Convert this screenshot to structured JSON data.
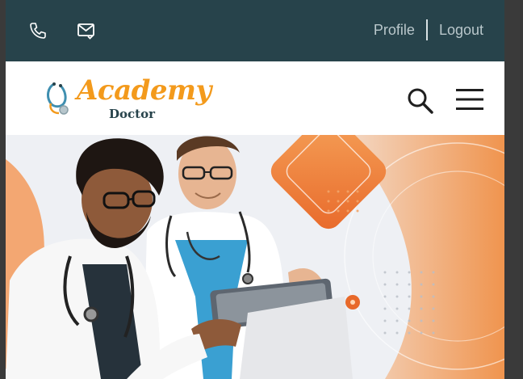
{
  "topbar": {
    "phone_icon": "phone-icon",
    "mail_icon": "mail-check-icon",
    "profile_label": "Profile",
    "logout_label": "Logout",
    "background": "#27434b"
  },
  "header": {
    "logo_word1": "Academy",
    "logo_word2": "Doctor",
    "logo_accent": "#f39a1c",
    "search_icon": "search-icon",
    "menu_icon": "hamburger-menu-icon"
  },
  "hero": {
    "image": "doctors-with-tablet-photo",
    "accent": "#f07a2a"
  }
}
